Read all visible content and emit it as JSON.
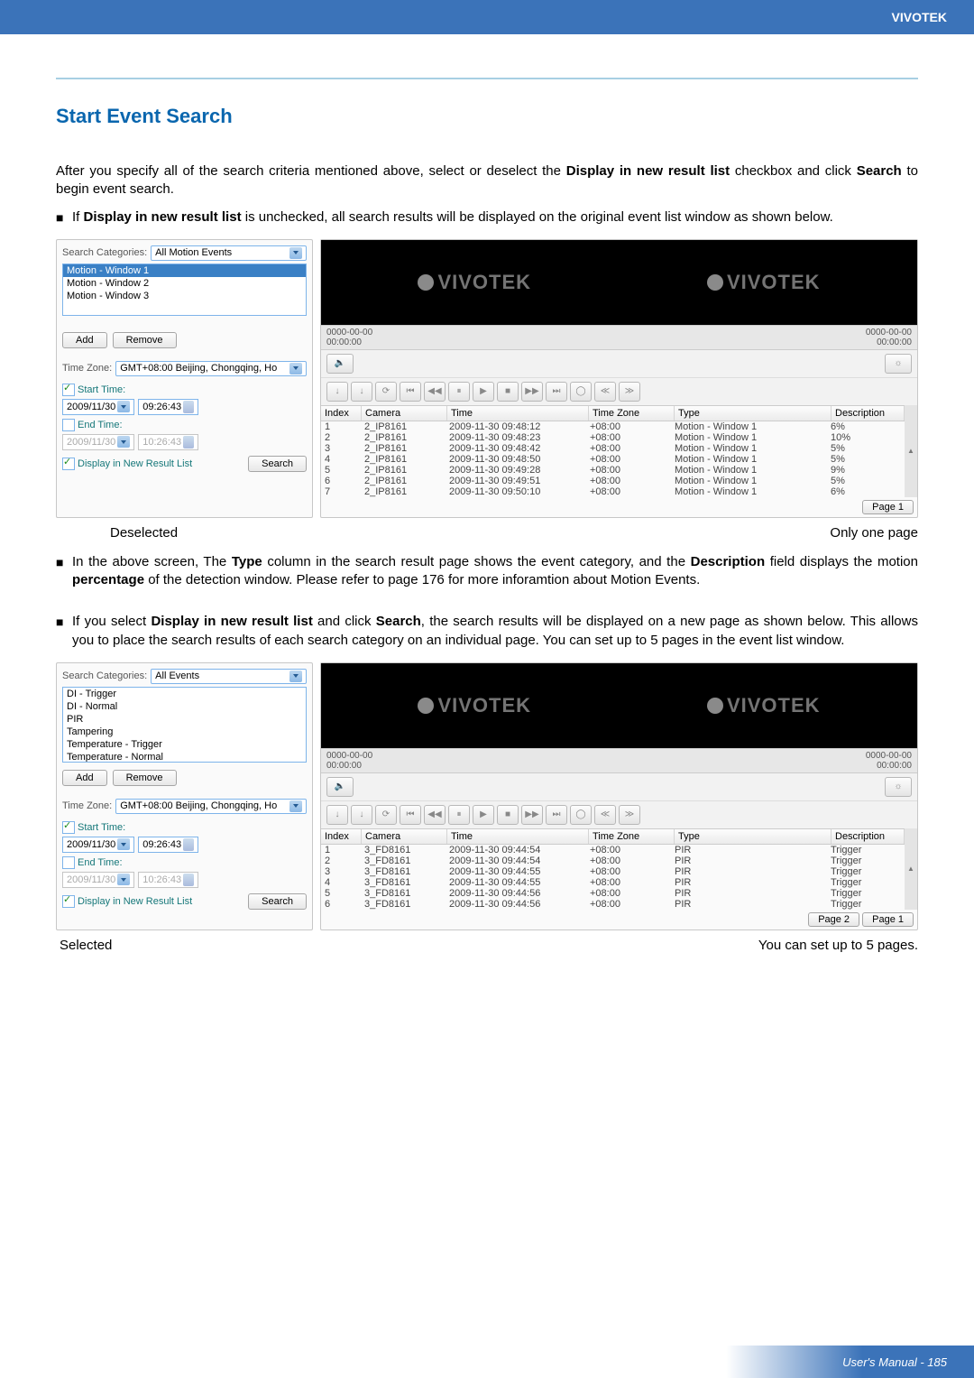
{
  "brand": "VIVOTEK",
  "heading": "Start Event Search",
  "intro_line1": "After you specify all of the search criteria mentioned above, select or deselect the ",
  "intro_bold1": "Display in new result list",
  "intro_line1b": " checkbox and click ",
  "intro_bold1b": "Search",
  "intro_line1c": " to begin event search.",
  "bullet1_a": "If ",
  "bullet1_b": "Display in new result list",
  "bullet1_c": " is unchecked, all search results will be displayed on the original event list window as shown below.",
  "panel": {
    "search_cat_label": "Search Categories:",
    "search_cat_sel": "All Motion Events",
    "items1": [
      "Motion - Window 1",
      "Motion - Window 2",
      "Motion - Window 3"
    ],
    "search_cat_sel2": "All Events",
    "items2": [
      "DI - Trigger",
      "DI - Normal",
      "PIR",
      "Tampering",
      "Temperature - Trigger",
      "Temperature - Normal"
    ],
    "add": "Add",
    "remove": "Remove",
    "tz_label": "Time Zone:",
    "tz_value": "GMT+08:00 Beijing, Chongqing, Ho",
    "start": "Start Time:",
    "start_date": "2009/11/30",
    "start_time": "09:26:43",
    "end": "End Time:",
    "end_date": "2009/11/30",
    "end_time": "10:26:43",
    "disp": "Display in New Result List",
    "search": "Search"
  },
  "timestamps": {
    "left": "0000-00-00\n00:00:00",
    "right": "0000-00-00\n00:00:00"
  },
  "watermark": "VIVOTEK",
  "table": {
    "headers": [
      "Index",
      "Camera",
      "Time",
      "Time Zone",
      "Type",
      "Description"
    ],
    "rows1": [
      [
        "1",
        "2_IP8161",
        "2009-11-30 09:48:12",
        "+08:00",
        "Motion - Window 1",
        "6%"
      ],
      [
        "2",
        "2_IP8161",
        "2009-11-30 09:48:23",
        "+08:00",
        "Motion - Window 1",
        "10%"
      ],
      [
        "3",
        "2_IP8161",
        "2009-11-30 09:48:42",
        "+08:00",
        "Motion - Window 1",
        "5%"
      ],
      [
        "4",
        "2_IP8161",
        "2009-11-30 09:48:50",
        "+08:00",
        "Motion - Window 1",
        "5%"
      ],
      [
        "5",
        "2_IP8161",
        "2009-11-30 09:49:28",
        "+08:00",
        "Motion - Window 1",
        "9%"
      ],
      [
        "6",
        "2_IP8161",
        "2009-11-30 09:49:51",
        "+08:00",
        "Motion - Window 1",
        "5%"
      ],
      [
        "7",
        "2_IP8161",
        "2009-11-30 09:50:10",
        "+08:00",
        "Motion - Window 1",
        "6%"
      ]
    ],
    "rows2": [
      [
        "1",
        "3_FD8161",
        "2009-11-30 09:44:54",
        "+08:00",
        "PIR",
        "Trigger"
      ],
      [
        "2",
        "3_FD8161",
        "2009-11-30 09:44:54",
        "+08:00",
        "PIR",
        "Trigger"
      ],
      [
        "3",
        "3_FD8161",
        "2009-11-30 09:44:55",
        "+08:00",
        "PIR",
        "Trigger"
      ],
      [
        "4",
        "3_FD8161",
        "2009-11-30 09:44:55",
        "+08:00",
        "PIR",
        "Trigger"
      ],
      [
        "5",
        "3_FD8161",
        "2009-11-30 09:44:56",
        "+08:00",
        "PIR",
        "Trigger"
      ],
      [
        "6",
        "3_FD8161",
        "2009-11-30 09:44:56",
        "+08:00",
        "PIR",
        "Trigger"
      ]
    ]
  },
  "page1": "Page 1",
  "page2": "Page 2",
  "cap1_left": "Deselected",
  "cap1_right": "Only one page",
  "bullet2_a": "In the above screen, The ",
  "bullet2_b": "Type",
  "bullet2_c": " column in the search result page shows the event category, and the ",
  "bullet2_d": "Description",
  "bullet2_e": " field displays the motion ",
  "bullet2_f": "percentage",
  "bullet2_g": " of the detection window. Please refer to page 176 for more inforamtion about Motion Events.",
  "bullet3_a": "If you select ",
  "bullet3_b": "Display in new result list",
  "bullet3_c": " and click ",
  "bullet3_d": "Search",
  "bullet3_e": ", the search results will be displayed on a new page as shown below. This allows you to place the search results of each search category on an individual page. You can set up to 5 pages in the event list window.",
  "cap2_left": "Selected",
  "cap2_right": "You can set up to 5 pages.",
  "footer": "User's Manual - 185"
}
